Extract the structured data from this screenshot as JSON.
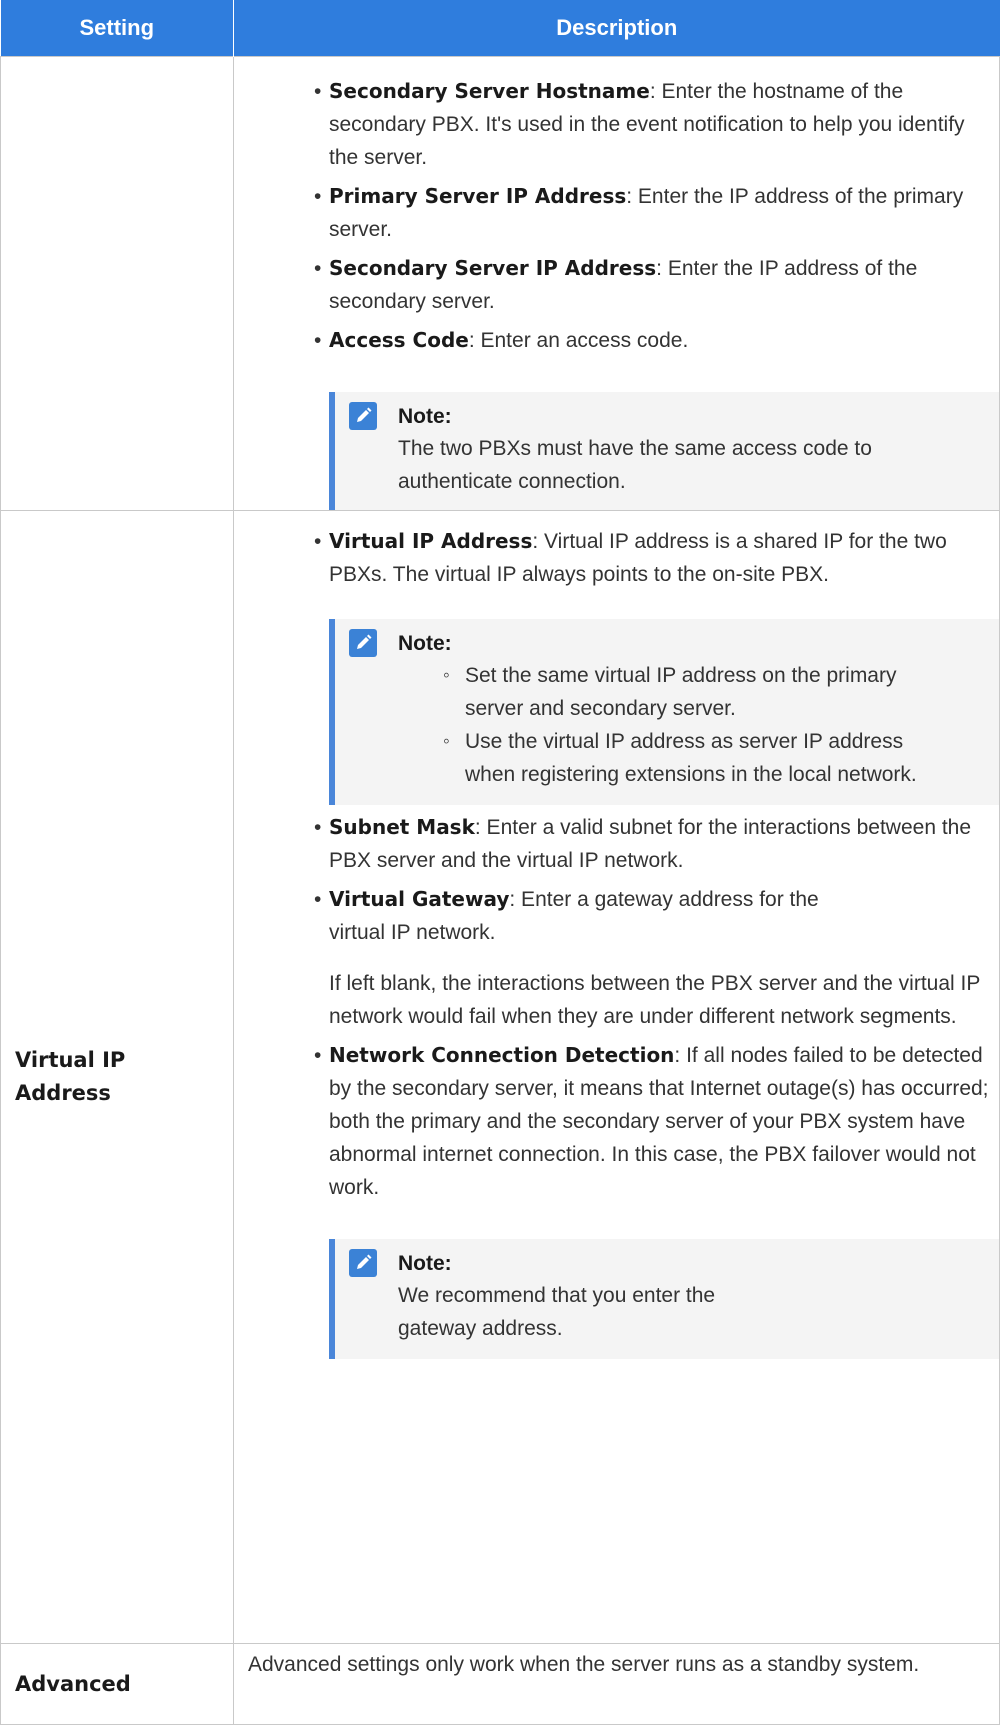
{
  "header": {
    "col1": "Setting",
    "col2": "Description"
  },
  "row1": {
    "items": [
      {
        "term": "Secondary Server Hostname",
        "text": ": Enter the hostname of the secondary PBX. It's used in the event notification to help you identify the server."
      },
      {
        "term": "Primary Server IP Address",
        "text": ": Enter the IP address of the primary server."
      },
      {
        "term": "Secondary Server IP Address",
        "text": ": Enter the IP address of the secondary server."
      },
      {
        "term": "Access Code",
        "text": ": Enter an access code."
      }
    ],
    "note": {
      "title": "Note:",
      "body": "The two PBXs must have the same access code to authenticate connection."
    }
  },
  "row2": {
    "setting": "Virtual IP Address",
    "vip": {
      "term": "Virtual IP Address",
      "text": ": Virtual IP address is a shared IP for the two PBXs. The virtual IP always points to the on-site PBX."
    },
    "note1": {
      "title": "Note:",
      "items": [
        "Set the same virtual IP address on the primary server and secondary server.",
        "Use the virtual IP address as server IP address when registering extensions in the local network."
      ]
    },
    "subnet": {
      "term": "Subnet Mask",
      "text": ": Enter a valid subnet for the interactions between the PBX server and the virtual IP network."
    },
    "gateway": {
      "term": "Virtual Gateway",
      "text": ": Enter a gateway address for the virtual IP network."
    },
    "gateway_para": "If left blank, the interactions between the PBX server and the virtual IP network would fail when they are under different network segments.",
    "detect": {
      "term": "Network Connection Detection",
      "text": ": If all nodes failed to be detected by the secondary server, it means that Internet outage(s) has occurred; both the primary and the secondary server of your PBX system have abnormal internet connection. In this case, the PBX failover would not work."
    },
    "note2": {
      "title": "Note:",
      "body": "We recommend that you enter the gateway address."
    }
  },
  "row3": {
    "setting": "Advanced",
    "desc": "Advanced settings only work when the server runs as a standby system."
  }
}
